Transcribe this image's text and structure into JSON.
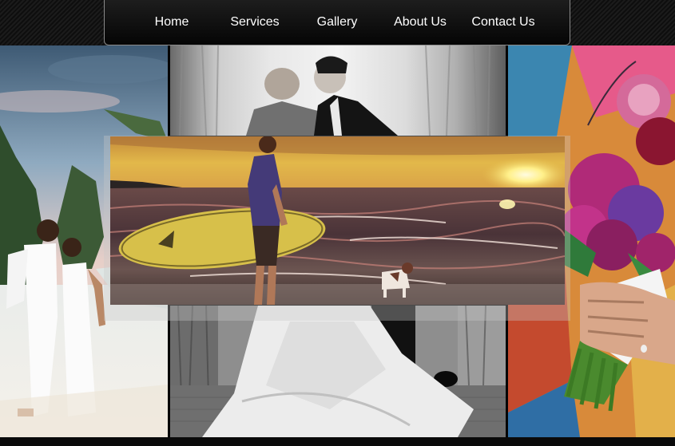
{
  "nav": {
    "items": [
      {
        "label": "Home",
        "active": true
      },
      {
        "label": "Services",
        "active": false
      },
      {
        "label": "Gallery",
        "active": false
      },
      {
        "label": "About Us",
        "active": false
      },
      {
        "label": "Contact Us",
        "active": false
      }
    ]
  },
  "gallery": {
    "photos": [
      {
        "name": "beach-couple-photo"
      },
      {
        "name": "kissing-couple-bw-photo"
      },
      {
        "name": "surfer-sunset-photo"
      },
      {
        "name": "wedding-dress-bw-photo"
      },
      {
        "name": "bridal-bouquet-photo"
      }
    ]
  },
  "colors": {
    "nav_text": "#ffffff",
    "nav_border": "#8a8a8a",
    "background": "#050505"
  }
}
